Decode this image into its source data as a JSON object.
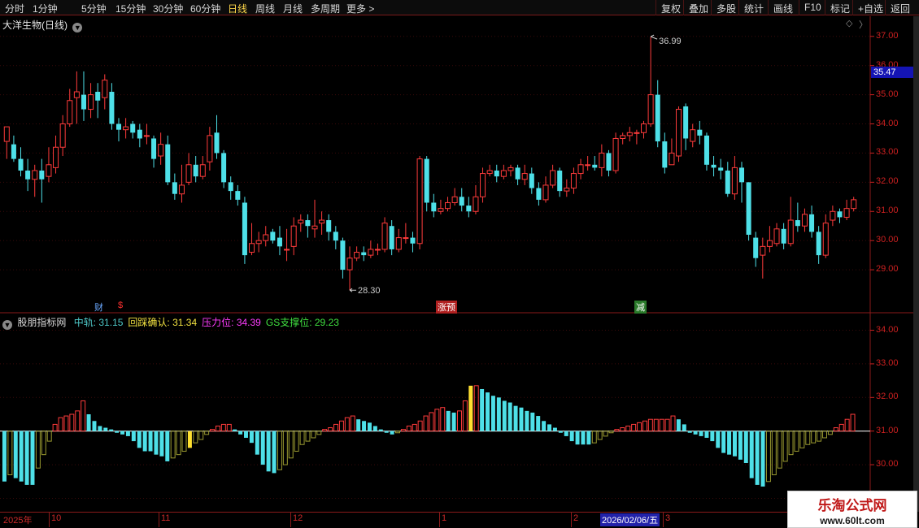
{
  "toolbar": {
    "periods": [
      "分时",
      "1分钟",
      "5分钟",
      "15分钟",
      "30分钟",
      "60分钟",
      "日线",
      "周线",
      "月线",
      "多周期",
      "更多 >"
    ],
    "active_period": "日线",
    "buttons": [
      "复权",
      "叠加",
      "多股",
      "统计",
      "画线",
      "F10",
      "标记",
      "+自选",
      "返回"
    ]
  },
  "main_chart": {
    "title": "大洋生物(日线)",
    "price_axis": [
      "37.00",
      "36.00",
      "35.00",
      "34.00",
      "33.00",
      "32.00",
      "31.00",
      "30.00",
      "29.00"
    ],
    "current_price_tag": "35.47",
    "high_label": "36.99",
    "low_label": "28.30",
    "event_badges": [
      {
        "text": "财",
        "color": "#6aa8ff"
      },
      {
        "text": "$",
        "color": "#ff3030"
      },
      {
        "text": "涨预",
        "color": "#ffffff",
        "bg": "#b02020"
      },
      {
        "text": "减",
        "color": "#ffffff",
        "bg": "#2a7a2a"
      }
    ],
    "up_color": "#ff3b3b",
    "down_color": "#4ee0e8"
  },
  "indicator": {
    "name": "股朋指标网",
    "items": [
      {
        "label": "中轨:",
        "value": "31.15",
        "color": "#4ec8c8"
      },
      {
        "label": "回踩确认:",
        "value": "31.34",
        "color": "#f0e040"
      },
      {
        "label": "压力位:",
        "value": "34.39",
        "color": "#ff3cff"
      },
      {
        "label": "GS支撑位:",
        "value": "29.23",
        "color": "#40e040"
      }
    ],
    "axis": [
      "34.00",
      "33.00",
      "32.00",
      "31.00",
      "30.00",
      "29.00"
    ]
  },
  "time_axis": {
    "ticks": [
      "2025年",
      "10",
      "11",
      "12",
      "1",
      "2",
      "2026/02/06/五",
      "3"
    ]
  },
  "watermark": {
    "title": "乐淘公式网",
    "url": "www.60lt.com"
  },
  "chart_data": {
    "type": "candlestick",
    "y_range": [
      28.0,
      37.3
    ],
    "candles": [
      [
        33.4,
        33.9,
        33.9,
        32.8
      ],
      [
        33.3,
        32.8,
        33.6,
        32.7
      ],
      [
        32.8,
        32.4,
        33.2,
        32.2
      ],
      [
        32.4,
        32.1,
        32.8,
        31.7
      ],
      [
        32.1,
        32.4,
        32.6,
        31.5
      ],
      [
        32.4,
        32.1,
        32.8,
        31.3
      ],
      [
        32.2,
        32.6,
        33.2,
        32.0
      ],
      [
        32.5,
        33.2,
        33.6,
        32.3
      ],
      [
        33.2,
        34.0,
        34.3,
        32.9
      ],
      [
        34.0,
        34.8,
        35.2,
        33.9
      ],
      [
        34.9,
        35.1,
        35.8,
        34.0
      ],
      [
        35.0,
        34.5,
        35.8,
        34.1
      ],
      [
        34.5,
        35.0,
        35.4,
        34.2
      ],
      [
        35.1,
        34.8,
        35.4,
        34.2
      ],
      [
        34.9,
        35.5,
        35.7,
        34.5
      ],
      [
        35.1,
        34.0,
        35.4,
        33.8
      ],
      [
        34.0,
        33.8,
        34.2,
        33.4
      ],
      [
        33.8,
        33.9,
        34.2,
        33.5
      ],
      [
        34.0,
        33.7,
        34.1,
        33.5
      ],
      [
        33.8,
        33.5,
        34.0,
        33.2
      ],
      [
        33.6,
        33.6,
        34.0,
        33.3
      ],
      [
        33.5,
        32.8,
        33.6,
        32.5
      ],
      [
        32.9,
        33.3,
        33.7,
        32.6
      ],
      [
        33.3,
        32.0,
        33.6,
        31.9
      ],
      [
        32.0,
        31.6,
        32.3,
        31.4
      ],
      [
        31.6,
        31.9,
        32.6,
        31.3
      ],
      [
        32.0,
        32.6,
        33.0,
        31.9
      ],
      [
        32.6,
        32.2,
        32.9,
        32.0
      ],
      [
        32.2,
        32.6,
        32.9,
        32.1
      ],
      [
        32.7,
        33.6,
        33.9,
        32.4
      ],
      [
        33.7,
        33.0,
        34.3,
        32.8
      ],
      [
        33.0,
        32.0,
        33.1,
        31.8
      ],
      [
        32.0,
        31.7,
        32.2,
        31.4
      ],
      [
        31.7,
        31.4,
        31.9,
        31.2
      ],
      [
        31.3,
        29.5,
        31.5,
        29.2
      ],
      [
        29.6,
        29.9,
        30.6,
        29.5
      ],
      [
        29.9,
        30.0,
        30.3,
        29.6
      ],
      [
        30.0,
        30.2,
        30.5,
        29.8
      ],
      [
        30.3,
        30.0,
        30.4,
        29.9
      ],
      [
        30.1,
        29.8,
        30.5,
        29.5
      ],
      [
        29.7,
        29.7,
        30.4,
        29.3
      ],
      [
        29.8,
        30.5,
        30.8,
        29.5
      ],
      [
        30.6,
        30.7,
        30.9,
        30.3
      ],
      [
        30.7,
        30.5,
        30.9,
        30.1
      ],
      [
        30.4,
        30.5,
        31.4,
        30.1
      ],
      [
        30.6,
        30.7,
        31.0,
        30.2
      ],
      [
        30.7,
        30.3,
        30.9,
        30.0
      ],
      [
        30.3,
        30.0,
        30.5,
        29.7
      ],
      [
        30.0,
        29.0,
        30.1,
        28.7
      ],
      [
        29.0,
        29.4,
        29.8,
        28.3
      ],
      [
        29.4,
        29.6,
        29.8,
        29.3
      ],
      [
        29.6,
        29.5,
        29.8,
        29.3
      ],
      [
        29.5,
        29.7,
        30.0,
        29.4
      ],
      [
        29.7,
        29.7,
        29.9,
        29.5
      ],
      [
        29.7,
        30.6,
        30.8,
        29.6
      ],
      [
        30.5,
        29.7,
        30.7,
        29.5
      ],
      [
        29.7,
        30.1,
        30.4,
        29.6
      ],
      [
        30.1,
        30.1,
        30.6,
        29.9
      ],
      [
        30.1,
        29.9,
        30.3,
        29.6
      ],
      [
        29.9,
        32.8,
        32.9,
        29.7
      ],
      [
        32.8,
        31.3,
        32.9,
        31.0
      ],
      [
        31.3,
        31.0,
        31.6,
        30.8
      ],
      [
        31.0,
        31.1,
        31.4,
        30.9
      ],
      [
        31.1,
        31.3,
        31.5,
        31.0
      ],
      [
        31.3,
        31.5,
        31.8,
        31.2
      ],
      [
        31.5,
        31.2,
        31.8,
        31.0
      ],
      [
        31.2,
        31.0,
        31.5,
        30.8
      ],
      [
        31.0,
        31.5,
        31.9,
        30.9
      ],
      [
        31.5,
        32.3,
        32.5,
        31.3
      ],
      [
        32.3,
        32.4,
        32.6,
        32.2
      ],
      [
        32.4,
        32.2,
        32.6,
        32.0
      ],
      [
        32.2,
        32.4,
        32.6,
        32.1
      ],
      [
        32.4,
        32.5,
        32.6,
        32.2
      ],
      [
        32.5,
        32.1,
        32.6,
        31.9
      ],
      [
        32.1,
        32.3,
        32.6,
        31.9
      ],
      [
        32.3,
        31.8,
        32.5,
        31.6
      ],
      [
        31.8,
        31.4,
        32.0,
        31.2
      ],
      [
        31.4,
        31.9,
        32.2,
        31.3
      ],
      [
        31.9,
        32.4,
        32.6,
        31.8
      ],
      [
        32.4,
        31.7,
        32.5,
        31.5
      ],
      [
        31.7,
        31.8,
        32.1,
        31.5
      ],
      [
        31.8,
        32.3,
        32.5,
        31.6
      ],
      [
        32.3,
        32.6,
        32.8,
        32.1
      ],
      [
        32.6,
        32.6,
        32.9,
        32.4
      ],
      [
        32.6,
        32.5,
        32.9,
        32.4
      ],
      [
        32.5,
        33.0,
        33.3,
        32.2
      ],
      [
        33.0,
        32.4,
        33.1,
        32.2
      ],
      [
        32.4,
        33.5,
        33.7,
        32.3
      ],
      [
        33.5,
        33.6,
        33.7,
        33.3
      ],
      [
        33.6,
        33.7,
        33.9,
        33.4
      ],
      [
        33.7,
        33.7,
        33.8,
        33.3
      ],
      [
        33.7,
        34.0,
        34.1,
        33.5
      ],
      [
        34.0,
        35.0,
        36.99,
        33.9
      ],
      [
        35.0,
        33.4,
        35.5,
        33.2
      ],
      [
        33.4,
        32.5,
        33.7,
        32.3
      ],
      [
        32.6,
        33.0,
        33.5,
        32.8
      ],
      [
        32.9,
        34.5,
        34.6,
        32.7
      ],
      [
        34.6,
        33.5,
        34.7,
        33.1
      ],
      [
        33.4,
        33.8,
        34.0,
        33.2
      ],
      [
        33.8,
        33.6,
        34.1,
        33.3
      ],
      [
        33.6,
        32.6,
        33.7,
        32.4
      ],
      [
        32.6,
        32.5,
        32.9,
        32.2
      ],
      [
        32.5,
        32.4,
        32.8,
        32.1
      ],
      [
        32.4,
        31.6,
        32.7,
        31.5
      ],
      [
        31.6,
        32.5,
        32.9,
        31.4
      ],
      [
        32.5,
        32.0,
        32.7,
        31.3
      ],
      [
        32.0,
        30.2,
        32.0,
        30.0
      ],
      [
        30.1,
        29.4,
        30.3,
        29.1
      ],
      [
        29.5,
        29.8,
        30.1,
        28.7
      ],
      [
        29.8,
        30.0,
        30.5,
        29.6
      ],
      [
        29.9,
        30.4,
        30.6,
        29.8
      ],
      [
        30.4,
        29.9,
        30.6,
        29.7
      ],
      [
        29.9,
        30.7,
        31.5,
        29.8
      ],
      [
        30.7,
        30.5,
        31.3,
        30.3
      ],
      [
        30.5,
        30.9,
        31.1,
        30.3
      ],
      [
        30.9,
        30.3,
        31.2,
        30.1
      ],
      [
        30.3,
        29.5,
        30.5,
        29.2
      ],
      [
        29.5,
        30.6,
        30.9,
        29.4
      ],
      [
        30.7,
        31.0,
        31.2,
        30.5
      ],
      [
        31.0,
        30.8,
        31.1,
        30.6
      ],
      [
        30.8,
        31.1,
        31.4,
        30.7
      ],
      [
        31.1,
        31.4,
        31.5,
        31.0
      ]
    ],
    "histogram": [
      -1.5,
      -1.3,
      -1.4,
      -1.5,
      -1.6,
      -1.6,
      -1.1,
      -0.7,
      -0.3,
      0.2,
      0.4,
      0.45,
      0.5,
      0.6,
      0.9,
      0.5,
      0.3,
      0.15,
      0.1,
      0.05,
      -0.05,
      -0.1,
      -0.15,
      -0.3,
      -0.5,
      -0.6,
      -0.6,
      -0.7,
      -0.75,
      -0.9,
      -0.8,
      -0.7,
      -0.6,
      -0.5,
      -0.35,
      -0.25,
      -0.1,
      0.05,
      0.15,
      0.2,
      0.2,
      0.05,
      -0.1,
      -0.2,
      -0.35,
      -0.7,
      -1.0,
      -1.2,
      -1.25,
      -1.15,
      -1.0,
      -0.8,
      -0.6,
      -0.4,
      -0.3,
      -0.2,
      -0.1,
      0.05,
      0.1,
      0.2,
      0.3,
      0.4,
      0.45,
      0.35,
      0.3,
      0.25,
      0.15,
      0.05,
      -0.05,
      -0.1,
      -0.05,
      0.05,
      0.15,
      0.2,
      0.3,
      0.45,
      0.55,
      0.65,
      0.7,
      0.6,
      0.55,
      0.6,
      0.9,
      1.35,
      1.35,
      1.25,
      1.15,
      1.05,
      1.0,
      0.9,
      0.85,
      0.75,
      0.7,
      0.6,
      0.55,
      0.45,
      0.3,
      0.2,
      0.1,
      -0.05,
      -0.15,
      -0.3,
      -0.4,
      -0.4,
      -0.4,
      -0.35,
      -0.25,
      -0.15,
      -0.05,
      0.05,
      0.1,
      0.15,
      0.2,
      0.25,
      0.3,
      0.35,
      0.35,
      0.35,
      0.35,
      0.45,
      0.35,
      0.2,
      -0.05,
      -0.1,
      -0.15,
      -0.2,
      -0.3,
      -0.5,
      -0.65,
      -0.7,
      -0.75,
      -0.85,
      -0.95,
      -1.4,
      -1.6,
      -1.65,
      -1.5,
      -1.3,
      -1.1,
      -0.9,
      -0.7,
      -0.6,
      -0.5,
      -0.4,
      -0.35,
      -0.3,
      -0.2,
      -0.1,
      0.1,
      0.2,
      0.35,
      0.5
    ],
    "hist_highlight_indices": [
      33,
      83
    ]
  }
}
